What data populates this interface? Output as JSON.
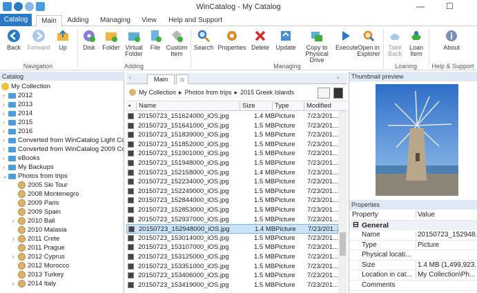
{
  "window": {
    "title": "WinCatalog - My Catalog"
  },
  "tabs": [
    {
      "label": "Catalog"
    },
    {
      "label": "Main"
    },
    {
      "label": "Adding"
    },
    {
      "label": "Managing"
    },
    {
      "label": "View"
    },
    {
      "label": "Help and Support"
    }
  ],
  "ribbon": {
    "navigation": {
      "label": "Navigation",
      "back": "Back",
      "forward": "Forward",
      "up": "Up"
    },
    "adding": {
      "label": "Adding",
      "disk": "Disk",
      "folder": "Folder",
      "virtual_folder": "Virtual Folder",
      "file": "File",
      "custom_item": "Custom Item"
    },
    "managing": {
      "label": "Managing",
      "search": "Search",
      "properties": "Properties",
      "delete": "Delete",
      "update": "Update",
      "copy": "Copy to Physical Drive",
      "execute": "Execute",
      "open_explorer": "Open in Explorer"
    },
    "loaning": {
      "label": "Loaning",
      "take_back": "Take Back",
      "loan_item": "Loan Item"
    },
    "help": {
      "label": "Help & Support",
      "about": "About"
    }
  },
  "catalog_pane": {
    "header": "Catalog",
    "items": [
      {
        "label": "My Collection",
        "kind": "collection",
        "level": 0,
        "chev": ""
      },
      {
        "label": "2012",
        "kind": "folder",
        "level": 0,
        "chev": "›"
      },
      {
        "label": "2013",
        "kind": "folder",
        "level": 0,
        "chev": "›"
      },
      {
        "label": "2014",
        "kind": "folder",
        "level": 0,
        "chev": "›"
      },
      {
        "label": "2015",
        "kind": "folder",
        "level": 0,
        "chev": "›"
      },
      {
        "label": "2016",
        "kind": "folder",
        "level": 0,
        "chev": "›"
      },
      {
        "label": "Converted from WinCatalog Light Coll",
        "kind": "folder",
        "level": 0,
        "chev": "›"
      },
      {
        "label": "Converted from WinCatalog 2009 Coll",
        "kind": "folder",
        "level": 0,
        "chev": "›"
      },
      {
        "label": "eBooks",
        "kind": "folder",
        "level": 0,
        "chev": "›"
      },
      {
        "label": "My Backups",
        "kind": "folder",
        "level": 0,
        "chev": "›"
      },
      {
        "label": "Photos from trips",
        "kind": "folder",
        "level": 0,
        "chev": "⌄"
      },
      {
        "label": "2005 Ski Tour",
        "kind": "album",
        "level": 1,
        "chev": ""
      },
      {
        "label": "2008 Montenegro",
        "kind": "album",
        "level": 1,
        "chev": ""
      },
      {
        "label": "2009 Paris",
        "kind": "album",
        "level": 1,
        "chev": ""
      },
      {
        "label": "2009 Spain",
        "kind": "album",
        "level": 1,
        "chev": ""
      },
      {
        "label": "2010 Bali",
        "kind": "album",
        "level": 1,
        "chev": "›"
      },
      {
        "label": "2010 Malasia",
        "kind": "album",
        "level": 1,
        "chev": ""
      },
      {
        "label": "2011 Crete",
        "kind": "album",
        "level": 1,
        "chev": "›"
      },
      {
        "label": "2011 Prague",
        "kind": "album",
        "level": 1,
        "chev": ""
      },
      {
        "label": "2012 Cyprus",
        "kind": "album",
        "level": 1,
        "chev": "›"
      },
      {
        "label": "2012 Morocco",
        "kind": "album",
        "level": 1,
        "chev": ""
      },
      {
        "label": "2013 Turkey",
        "kind": "album",
        "level": 1,
        "chev": ""
      },
      {
        "label": "2014 Italy",
        "kind": "album",
        "level": 1,
        "chev": "›"
      }
    ]
  },
  "center": {
    "tab": "Main",
    "breadcrumb": [
      "My Collection",
      "Photos from trips",
      "2015 Greek Islands"
    ],
    "columns": [
      "Name",
      "Size",
      "Type",
      "Modified"
    ],
    "rows": [
      {
        "name": "20150723_151624000_iOS.jpg",
        "size": "1.4 MB",
        "type": "Picture",
        "modified": "7/23/201..."
      },
      {
        "name": "20150723_151641000_iOS.jpg",
        "size": "1.5 MB",
        "type": "Picture",
        "modified": "7/23/201..."
      },
      {
        "name": "20150723_151839000_iOS.jpg",
        "size": "1.5 MB",
        "type": "Picture",
        "modified": "7/23/201..."
      },
      {
        "name": "20150723_151852000_iOS.jpg",
        "size": "1.5 MB",
        "type": "Picture",
        "modified": "7/23/201..."
      },
      {
        "name": "20150723_151901000_iOS.jpg",
        "size": "1.5 MB",
        "type": "Picture",
        "modified": "7/23/201..."
      },
      {
        "name": "20150723_151948000_iOS.jpg",
        "size": "1.5 MB",
        "type": "Picture",
        "modified": "7/23/201..."
      },
      {
        "name": "20150723_152158000_iOS.jpg",
        "size": "1.4 MB",
        "type": "Picture",
        "modified": "7/23/201..."
      },
      {
        "name": "20150723_152234000_iOS.jpg",
        "size": "1.5 MB",
        "type": "Picture",
        "modified": "7/23/201..."
      },
      {
        "name": "20150723_152249000_iOS.jpg",
        "size": "1.5 MB",
        "type": "Picture",
        "modified": "7/23/201..."
      },
      {
        "name": "20150723_152844000_iOS.jpg",
        "size": "1.5 MB",
        "type": "Picture",
        "modified": "7/23/201..."
      },
      {
        "name": "20150723_152853000_iOS.jpg",
        "size": "1.5 MB",
        "type": "Picture",
        "modified": "7/23/201..."
      },
      {
        "name": "20150723_152937000_iOS.jpg",
        "size": "1.5 MB",
        "type": "Picture",
        "modified": "7/23/201..."
      },
      {
        "name": "20150723_152948000_iOS.jpg",
        "size": "1.4 MB",
        "type": "Picture",
        "modified": "7/23/201...",
        "selected": true
      },
      {
        "name": "20150723_153014000_iOS.jpg",
        "size": "1.5 MB",
        "type": "Picture",
        "modified": "7/23/201..."
      },
      {
        "name": "20150723_153107000_iOS.jpg",
        "size": "1.5 MB",
        "type": "Picture",
        "modified": "7/23/201..."
      },
      {
        "name": "20150723_153125000_iOS.jpg",
        "size": "1.5 MB",
        "type": "Picture",
        "modified": "7/23/201..."
      },
      {
        "name": "20150723_153351000_iOS.jpg",
        "size": "1.5 MB",
        "type": "Picture",
        "modified": "7/23/201..."
      },
      {
        "name": "20150723_153406000_iOS.jpg",
        "size": "1.5 MB",
        "type": "Picture",
        "modified": "7/23/201..."
      },
      {
        "name": "20150723_153419000_iOS.jpg",
        "size": "1.5 MB",
        "type": "Picture",
        "modified": "7/23/201..."
      }
    ]
  },
  "thumbnail": {
    "header": "Thumbnail preview"
  },
  "properties": {
    "header": "Properties",
    "col_property": "Property",
    "col_value": "Value",
    "group": "General",
    "rows": [
      {
        "k": "Name",
        "v": "20150723_152948..."
      },
      {
        "k": "Type",
        "v": "Picture"
      },
      {
        "k": "Physical locati...",
        "v": ""
      },
      {
        "k": "Size",
        "v": "1.4 MB (1,499,923..."
      },
      {
        "k": "Location in cat...",
        "v": "My Collection\\Ph..."
      },
      {
        "k": "Comments",
        "v": ""
      }
    ]
  },
  "colors": {
    "accent": "#2b78c5",
    "selection": "#cce4f7",
    "pane_header": "#dfe9f5"
  }
}
